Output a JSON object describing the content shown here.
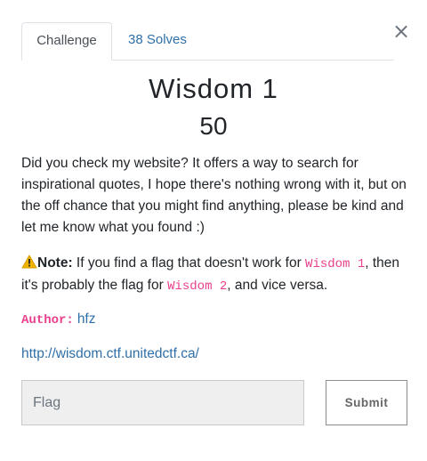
{
  "modal": {
    "close_label": "×"
  },
  "tabs": [
    {
      "label": "Challenge",
      "active": true
    },
    {
      "label": "38 Solves",
      "active": false
    }
  ],
  "challenge": {
    "title": "Wisdom 1",
    "points": "50",
    "description": "Did you check my website? It offers a way to search for inspirational quotes, I hope there's nothing wrong with it, but on the off chance that you might find anything, please be kind and let me know what you found :)",
    "note": {
      "icon": "warning-icon",
      "label": "Note:",
      "text_1": " If you find a flag that doesn't work for ",
      "code_1": "Wisdom 1",
      "text_2": ", then it's probably the flag for ",
      "code_2": "Wisdom 2",
      "text_3": ", and vice versa."
    },
    "author": {
      "label": "Author:",
      "name": "hfz"
    },
    "link": "http://wisdom.ctf.unitedctf.ca/"
  },
  "form": {
    "flag_placeholder": "Flag",
    "flag_value": "",
    "submit_label": "Submit"
  },
  "colors": {
    "link": "#2f6fa8",
    "code": "#e83e8c",
    "warning": "#f0b400"
  }
}
